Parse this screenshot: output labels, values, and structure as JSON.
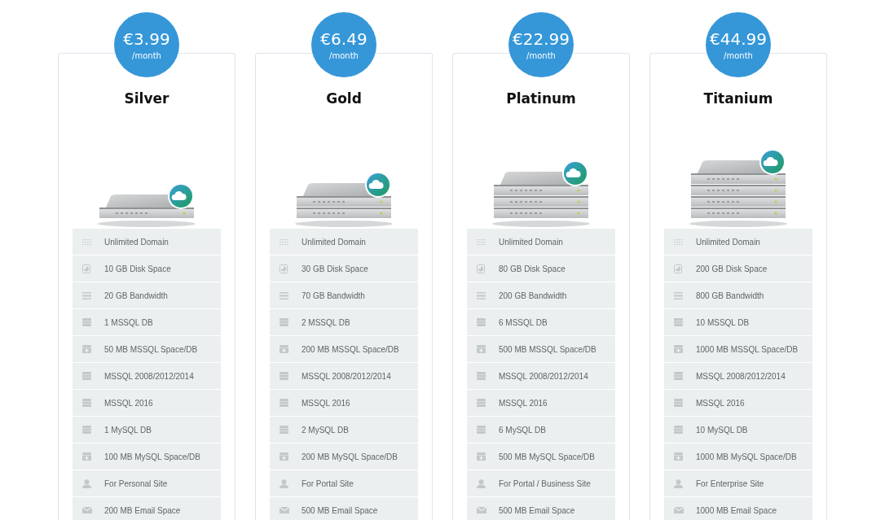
{
  "plans": [
    {
      "price": "€3.99",
      "period": "/month",
      "name": "Silver",
      "server": {
        "kind": "single"
      },
      "features": [
        {
          "kind": "domain",
          "text": "Unlimited Domain"
        },
        {
          "kind": "disk",
          "text": "10 GB Disk Space"
        },
        {
          "kind": "bandwidth",
          "text": "20 GB Bandwidth"
        },
        {
          "kind": "db",
          "text": "1 MSSQL DB"
        },
        {
          "kind": "db-space",
          "text": "50 MB MSSQL Space/DB"
        },
        {
          "kind": "db",
          "text": "MSSQL 2008/2012/2014"
        },
        {
          "kind": "db",
          "text": "MSSQL 2016"
        },
        {
          "kind": "db",
          "text": "1 MySQL DB"
        },
        {
          "kind": "db-space",
          "text": "100 MB MySQL Space/DB"
        },
        {
          "kind": "user",
          "text": "For Personal Site"
        },
        {
          "kind": "email",
          "text": "200 MB Email Space"
        }
      ]
    },
    {
      "price": "€6.49",
      "period": "/month",
      "name": "Gold",
      "server": {
        "kind": "double"
      },
      "features": [
        {
          "kind": "domain",
          "text": "Unlimited Domain"
        },
        {
          "kind": "disk",
          "text": "30 GB Disk Space"
        },
        {
          "kind": "bandwidth",
          "text": "70 GB Bandwidth"
        },
        {
          "kind": "db",
          "text": "2 MSSQL DB"
        },
        {
          "kind": "db-space",
          "text": "200 MB MSSQL Space/DB"
        },
        {
          "kind": "db",
          "text": "MSSQL 2008/2012/2014"
        },
        {
          "kind": "db",
          "text": "MSSQL 2016"
        },
        {
          "kind": "db",
          "text": "2 MySQL DB"
        },
        {
          "kind": "db-space",
          "text": "200 MB MySQL Space/DB"
        },
        {
          "kind": "user",
          "text": "For Portal Site"
        },
        {
          "kind": "email",
          "text": "500 MB Email Space"
        }
      ]
    },
    {
      "price": "€22.99",
      "period": "/month",
      "name": "Platinum",
      "server": {
        "kind": "triple"
      },
      "features": [
        {
          "kind": "domain",
          "text": "Unlimited Domain"
        },
        {
          "kind": "disk",
          "text": "80 GB Disk Space"
        },
        {
          "kind": "bandwidth",
          "text": "200 GB Bandwidth"
        },
        {
          "kind": "db",
          "text": "6 MSSQL DB"
        },
        {
          "kind": "db-space",
          "text": "500 MB MSSQL Space/DB"
        },
        {
          "kind": "db",
          "text": "MSSQL 2008/2012/2014"
        },
        {
          "kind": "db",
          "text": "MSSQL 2016"
        },
        {
          "kind": "db",
          "text": "6 MySQL DB"
        },
        {
          "kind": "db-space",
          "text": "500 MB MySQL Space/DB"
        },
        {
          "kind": "user",
          "text": "For Portal / Business Site"
        },
        {
          "kind": "email",
          "text": "500 MB Email Space"
        }
      ]
    },
    {
      "price": "€44.99",
      "period": "/month",
      "name": "Titanium",
      "server": {
        "kind": "quad"
      },
      "features": [
        {
          "kind": "domain",
          "text": "Unlimited Domain"
        },
        {
          "kind": "disk",
          "text": "200 GB Disk Space"
        },
        {
          "kind": "bandwidth",
          "text": "800 GB Bandwidth"
        },
        {
          "kind": "db",
          "text": "10 MSSQL DB"
        },
        {
          "kind": "db-space",
          "text": "1000 MB MSSQL Space/DB"
        },
        {
          "kind": "db",
          "text": "MSSQL 2008/2012/2014"
        },
        {
          "kind": "db",
          "text": "MSSQL 2016"
        },
        {
          "kind": "db",
          "text": "10 MySQL DB"
        },
        {
          "kind": "db-space",
          "text": "1000 MB MySQL Space/DB"
        },
        {
          "kind": "user",
          "text": "For Enterprise Site"
        },
        {
          "kind": "email",
          "text": "1000 MB Email Space"
        }
      ]
    }
  ]
}
